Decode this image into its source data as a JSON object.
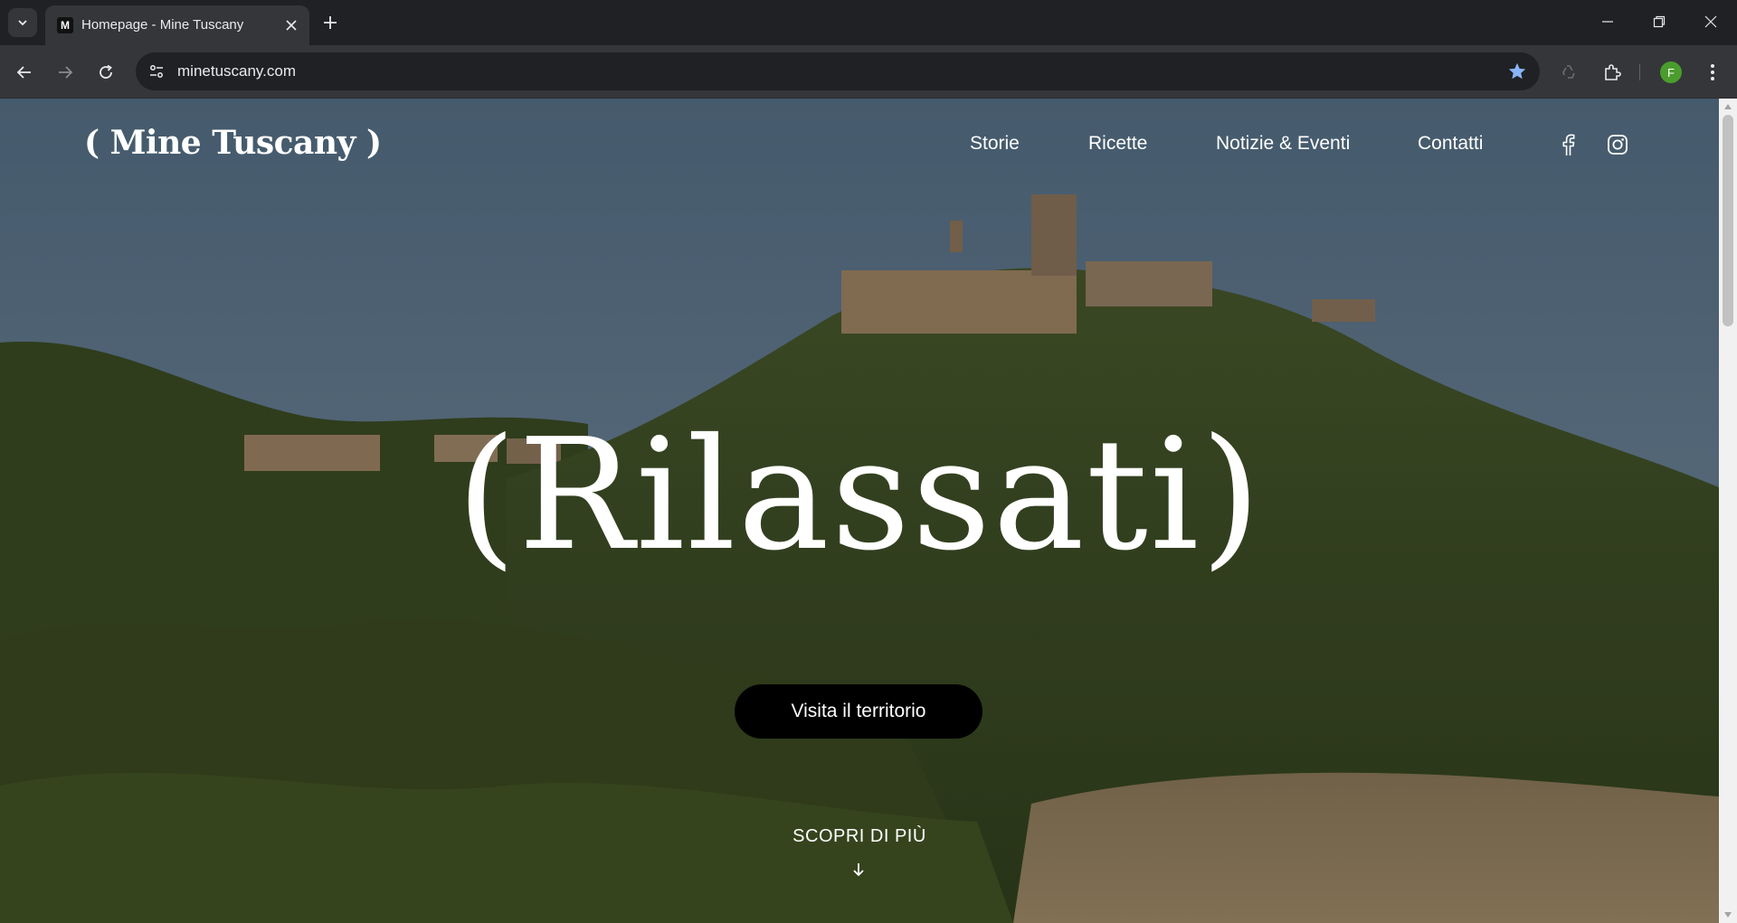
{
  "browser": {
    "tab": {
      "title": "Homepage - Mine Tuscany",
      "favicon_letter": "M"
    },
    "omnibox": {
      "url": "minetuscany.com"
    },
    "profile_initial": "F",
    "icons": {
      "tab_search": "chevron-down-icon",
      "tab_close": "close-icon",
      "new_tab": "plus-icon",
      "back": "arrow-left-icon",
      "forward": "arrow-right-icon",
      "reload": "reload-icon",
      "site_info": "tune-icon",
      "bookmark": "star-icon",
      "extensions": "puzzle-icon",
      "menu": "kebab-icon"
    },
    "accent_colors": {
      "bookmark_star": "#8ab4f8",
      "avatar": "#4a9c2d"
    }
  },
  "site": {
    "logo": "( Mine Tuscany )",
    "nav": [
      "Storie",
      "Ricette",
      "Notizie & Eventi",
      "Contatti"
    ],
    "social": [
      "facebook-icon",
      "instagram-icon"
    ],
    "hero": {
      "headline": "(Rilassati)",
      "cta": "Visita il territorio",
      "scroll_hint": "SCOPRI DI PIÙ",
      "scroll_icon": "arrow-down-icon"
    }
  }
}
